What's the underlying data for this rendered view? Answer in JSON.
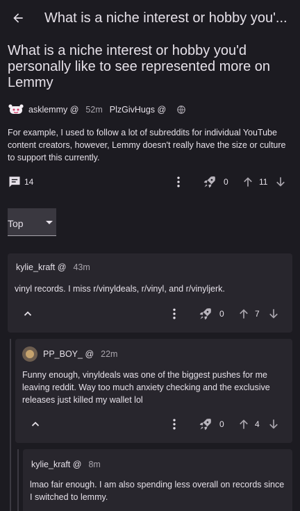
{
  "header": {
    "title": "What is a niche interest or hobby you'..."
  },
  "post": {
    "title": "What is a niche interest or hobby you'd personally like to see represented more on Lemmy",
    "community": "asklemmy @",
    "time": "52m",
    "author": "PlzGivHugs @",
    "body": "For example, I used to follow a lot of subreddits for individual YouTube content creators, however, Lemmy doesn't really have the size or culture to support this currently.",
    "comments": "14",
    "boosts": "0",
    "score": "11"
  },
  "sort": {
    "value": "Top"
  },
  "comments": [
    {
      "author": "kylie_kraft @",
      "time": "43m",
      "text": "vinyl records. I miss r/vinyldeals, r/vinyl, and r/vinyljerk.",
      "boosts": "0",
      "score": "7"
    },
    {
      "author": "PP_BOY_ @",
      "time": "22m",
      "text": "Funny enough, vinyldeals was one of the biggest pushes for me leaving reddit. Way too much anxiety checking and the exclusive releases just killed my wallet lol",
      "boosts": "0",
      "score": "4"
    },
    {
      "author": "kylie_kraft @",
      "time": "8m",
      "text": "lmao fair enough. I am also spending less overall on records since I switched to lemmy."
    }
  ],
  "colors": {
    "background": "#1c1b21",
    "card": "#28262d",
    "text": "#e6e1e9",
    "muted": "#a9a5ad"
  }
}
